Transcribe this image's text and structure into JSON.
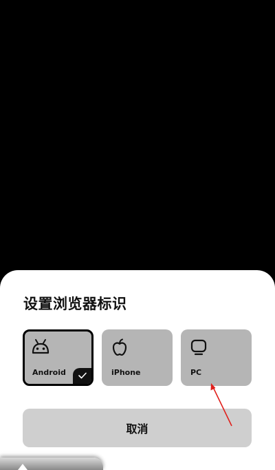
{
  "dialog": {
    "title": "设置浏览器标识",
    "options": [
      {
        "id": "android",
        "label": "Android",
        "icon": "android-icon",
        "selected": true
      },
      {
        "id": "iphone",
        "label": "iPhone",
        "icon": "apple-icon",
        "selected": false
      },
      {
        "id": "pc",
        "label": "PC",
        "icon": "monitor-icon",
        "selected": false
      }
    ],
    "cancel_label": "取消"
  },
  "colors": {
    "background": "#000000",
    "sheet": "#ffffff",
    "option_bg": "#b5b5b5",
    "selected_border": "#000000",
    "cancel_bg": "#cfcfcf",
    "annotation_arrow": "#e0201c"
  }
}
